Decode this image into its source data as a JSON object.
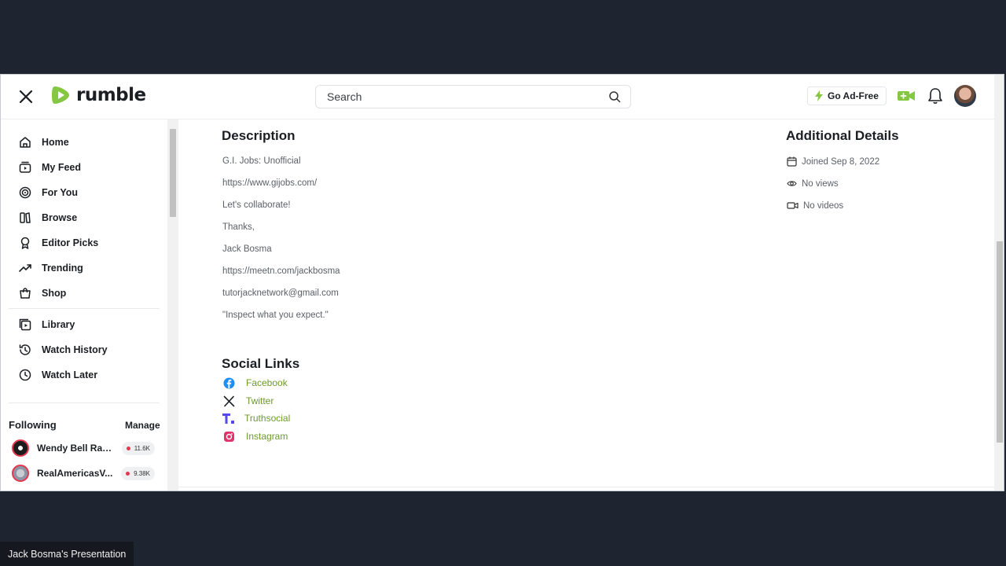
{
  "header": {
    "logo_text": "rumble",
    "search_placeholder": "Search",
    "go_ad_free_label": "Go Ad-Free",
    "brand_color": "#85c742"
  },
  "sidebar": {
    "items": [
      {
        "label": "Home",
        "icon": "home-icon"
      },
      {
        "label": "My Feed",
        "icon": "feed-icon"
      },
      {
        "label": "For You",
        "icon": "target-icon"
      },
      {
        "label": "Browse",
        "icon": "browse-icon"
      },
      {
        "label": "Editor Picks",
        "icon": "award-icon"
      },
      {
        "label": "Trending",
        "icon": "trending-icon"
      },
      {
        "label": "Shop",
        "icon": "shop-icon"
      },
      {
        "label": "Library",
        "icon": "library-icon"
      },
      {
        "label": "Watch History",
        "icon": "history-icon"
      },
      {
        "label": "Watch Later",
        "icon": "clock-icon"
      }
    ],
    "following_title": "Following",
    "manage_label": "Manage",
    "following": [
      {
        "name": "Wendy Bell Radio",
        "count": "11.6K"
      },
      {
        "name": "RealAmericasV...",
        "count": "9.38K"
      }
    ]
  },
  "description": {
    "title": "Description",
    "lines": [
      "G.I. Jobs: Unofficial",
      "https://www.gijobs.com/",
      "Let's collaborate!",
      "Thanks,",
      "Jack Bosma",
      "https://meetn.com/jackbosma",
      "tutorjacknetwork@gmail.com",
      "\"Inspect what you expect.\""
    ]
  },
  "details": {
    "title": "Additional Details",
    "joined": "Joined Sep 8, 2022",
    "views": "No views",
    "videos": "No videos"
  },
  "social": {
    "title": "Social Links",
    "links": [
      {
        "label": "Facebook",
        "icon": "facebook-icon"
      },
      {
        "label": "Twitter",
        "icon": "x-twitter-icon"
      },
      {
        "label": "Truthsocial",
        "icon": "truthsocial-icon"
      },
      {
        "label": "Instagram",
        "icon": "instagram-icon"
      }
    ]
  },
  "presenter_label": "Jack Bosma's Presentation"
}
